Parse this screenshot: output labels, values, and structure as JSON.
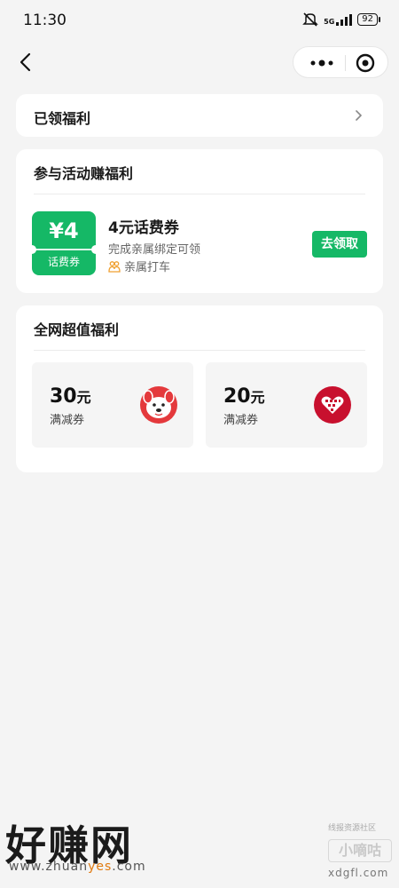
{
  "status_bar": {
    "time": "11:30",
    "network": "5G",
    "battery": "92"
  },
  "nav": {
    "back_icon": "chevron-left-icon",
    "more_icon": "more-dots-icon",
    "target_icon": "target-icon"
  },
  "received_benefits": {
    "title": "已领福利"
  },
  "activity": {
    "title": "参与活动赚福利",
    "coupon": {
      "amount": "¥4",
      "kind": "话费券",
      "name": "4元话费券",
      "condition": "完成亲属绑定可领",
      "source": "亲属打车",
      "claim_label": "去领取"
    }
  },
  "deals": {
    "title": "全网超值福利",
    "items": [
      {
        "amount": "30",
        "unit": "元",
        "label": "满减券",
        "logo": "jd-dog-logo-icon"
      },
      {
        "amount": "20",
        "unit": "元",
        "label": "满减券",
        "logo": "pinduoduo-heart-logo-icon"
      }
    ]
  },
  "watermark": {
    "big": "好赚网",
    "url_pre": "www.zhuan",
    "url_hl": "yes",
    "url_post": ".com",
    "small_top": "线报资源社区",
    "badge": "小嘀咕",
    "small_bottom": "xdgfl.com"
  },
  "colors": {
    "accent": "#15b866",
    "background": "#f4f4f4",
    "jd_red": "#e4393c",
    "pdd_red": "#c8102e"
  }
}
